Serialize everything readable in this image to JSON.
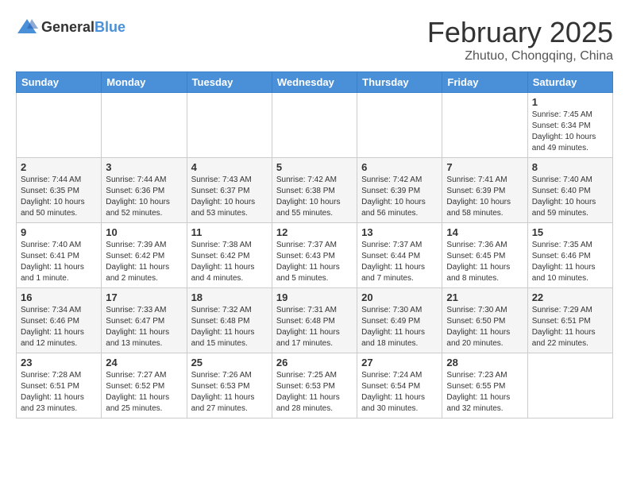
{
  "header": {
    "logo_general": "General",
    "logo_blue": "Blue",
    "month_title": "February 2025",
    "location": "Zhutuo, Chongqing, China"
  },
  "weekdays": [
    "Sunday",
    "Monday",
    "Tuesday",
    "Wednesday",
    "Thursday",
    "Friday",
    "Saturday"
  ],
  "weeks": [
    [
      {
        "day": "",
        "info": ""
      },
      {
        "day": "",
        "info": ""
      },
      {
        "day": "",
        "info": ""
      },
      {
        "day": "",
        "info": ""
      },
      {
        "day": "",
        "info": ""
      },
      {
        "day": "",
        "info": ""
      },
      {
        "day": "1",
        "info": "Sunrise: 7:45 AM\nSunset: 6:34 PM\nDaylight: 10 hours\nand 49 minutes."
      }
    ],
    [
      {
        "day": "2",
        "info": "Sunrise: 7:44 AM\nSunset: 6:35 PM\nDaylight: 10 hours\nand 50 minutes."
      },
      {
        "day": "3",
        "info": "Sunrise: 7:44 AM\nSunset: 6:36 PM\nDaylight: 10 hours\nand 52 minutes."
      },
      {
        "day": "4",
        "info": "Sunrise: 7:43 AM\nSunset: 6:37 PM\nDaylight: 10 hours\nand 53 minutes."
      },
      {
        "day": "5",
        "info": "Sunrise: 7:42 AM\nSunset: 6:38 PM\nDaylight: 10 hours\nand 55 minutes."
      },
      {
        "day": "6",
        "info": "Sunrise: 7:42 AM\nSunset: 6:39 PM\nDaylight: 10 hours\nand 56 minutes."
      },
      {
        "day": "7",
        "info": "Sunrise: 7:41 AM\nSunset: 6:39 PM\nDaylight: 10 hours\nand 58 minutes."
      },
      {
        "day": "8",
        "info": "Sunrise: 7:40 AM\nSunset: 6:40 PM\nDaylight: 10 hours\nand 59 minutes."
      }
    ],
    [
      {
        "day": "9",
        "info": "Sunrise: 7:40 AM\nSunset: 6:41 PM\nDaylight: 11 hours\nand 1 minute."
      },
      {
        "day": "10",
        "info": "Sunrise: 7:39 AM\nSunset: 6:42 PM\nDaylight: 11 hours\nand 2 minutes."
      },
      {
        "day": "11",
        "info": "Sunrise: 7:38 AM\nSunset: 6:42 PM\nDaylight: 11 hours\nand 4 minutes."
      },
      {
        "day": "12",
        "info": "Sunrise: 7:37 AM\nSunset: 6:43 PM\nDaylight: 11 hours\nand 5 minutes."
      },
      {
        "day": "13",
        "info": "Sunrise: 7:37 AM\nSunset: 6:44 PM\nDaylight: 11 hours\nand 7 minutes."
      },
      {
        "day": "14",
        "info": "Sunrise: 7:36 AM\nSunset: 6:45 PM\nDaylight: 11 hours\nand 8 minutes."
      },
      {
        "day": "15",
        "info": "Sunrise: 7:35 AM\nSunset: 6:46 PM\nDaylight: 11 hours\nand 10 minutes."
      }
    ],
    [
      {
        "day": "16",
        "info": "Sunrise: 7:34 AM\nSunset: 6:46 PM\nDaylight: 11 hours\nand 12 minutes."
      },
      {
        "day": "17",
        "info": "Sunrise: 7:33 AM\nSunset: 6:47 PM\nDaylight: 11 hours\nand 13 minutes."
      },
      {
        "day": "18",
        "info": "Sunrise: 7:32 AM\nSunset: 6:48 PM\nDaylight: 11 hours\nand 15 minutes."
      },
      {
        "day": "19",
        "info": "Sunrise: 7:31 AM\nSunset: 6:48 PM\nDaylight: 11 hours\nand 17 minutes."
      },
      {
        "day": "20",
        "info": "Sunrise: 7:30 AM\nSunset: 6:49 PM\nDaylight: 11 hours\nand 18 minutes."
      },
      {
        "day": "21",
        "info": "Sunrise: 7:30 AM\nSunset: 6:50 PM\nDaylight: 11 hours\nand 20 minutes."
      },
      {
        "day": "22",
        "info": "Sunrise: 7:29 AM\nSunset: 6:51 PM\nDaylight: 11 hours\nand 22 minutes."
      }
    ],
    [
      {
        "day": "23",
        "info": "Sunrise: 7:28 AM\nSunset: 6:51 PM\nDaylight: 11 hours\nand 23 minutes."
      },
      {
        "day": "24",
        "info": "Sunrise: 7:27 AM\nSunset: 6:52 PM\nDaylight: 11 hours\nand 25 minutes."
      },
      {
        "day": "25",
        "info": "Sunrise: 7:26 AM\nSunset: 6:53 PM\nDaylight: 11 hours\nand 27 minutes."
      },
      {
        "day": "26",
        "info": "Sunrise: 7:25 AM\nSunset: 6:53 PM\nDaylight: 11 hours\nand 28 minutes."
      },
      {
        "day": "27",
        "info": "Sunrise: 7:24 AM\nSunset: 6:54 PM\nDaylight: 11 hours\nand 30 minutes."
      },
      {
        "day": "28",
        "info": "Sunrise: 7:23 AM\nSunset: 6:55 PM\nDaylight: 11 hours\nand 32 minutes."
      },
      {
        "day": "",
        "info": ""
      }
    ]
  ]
}
